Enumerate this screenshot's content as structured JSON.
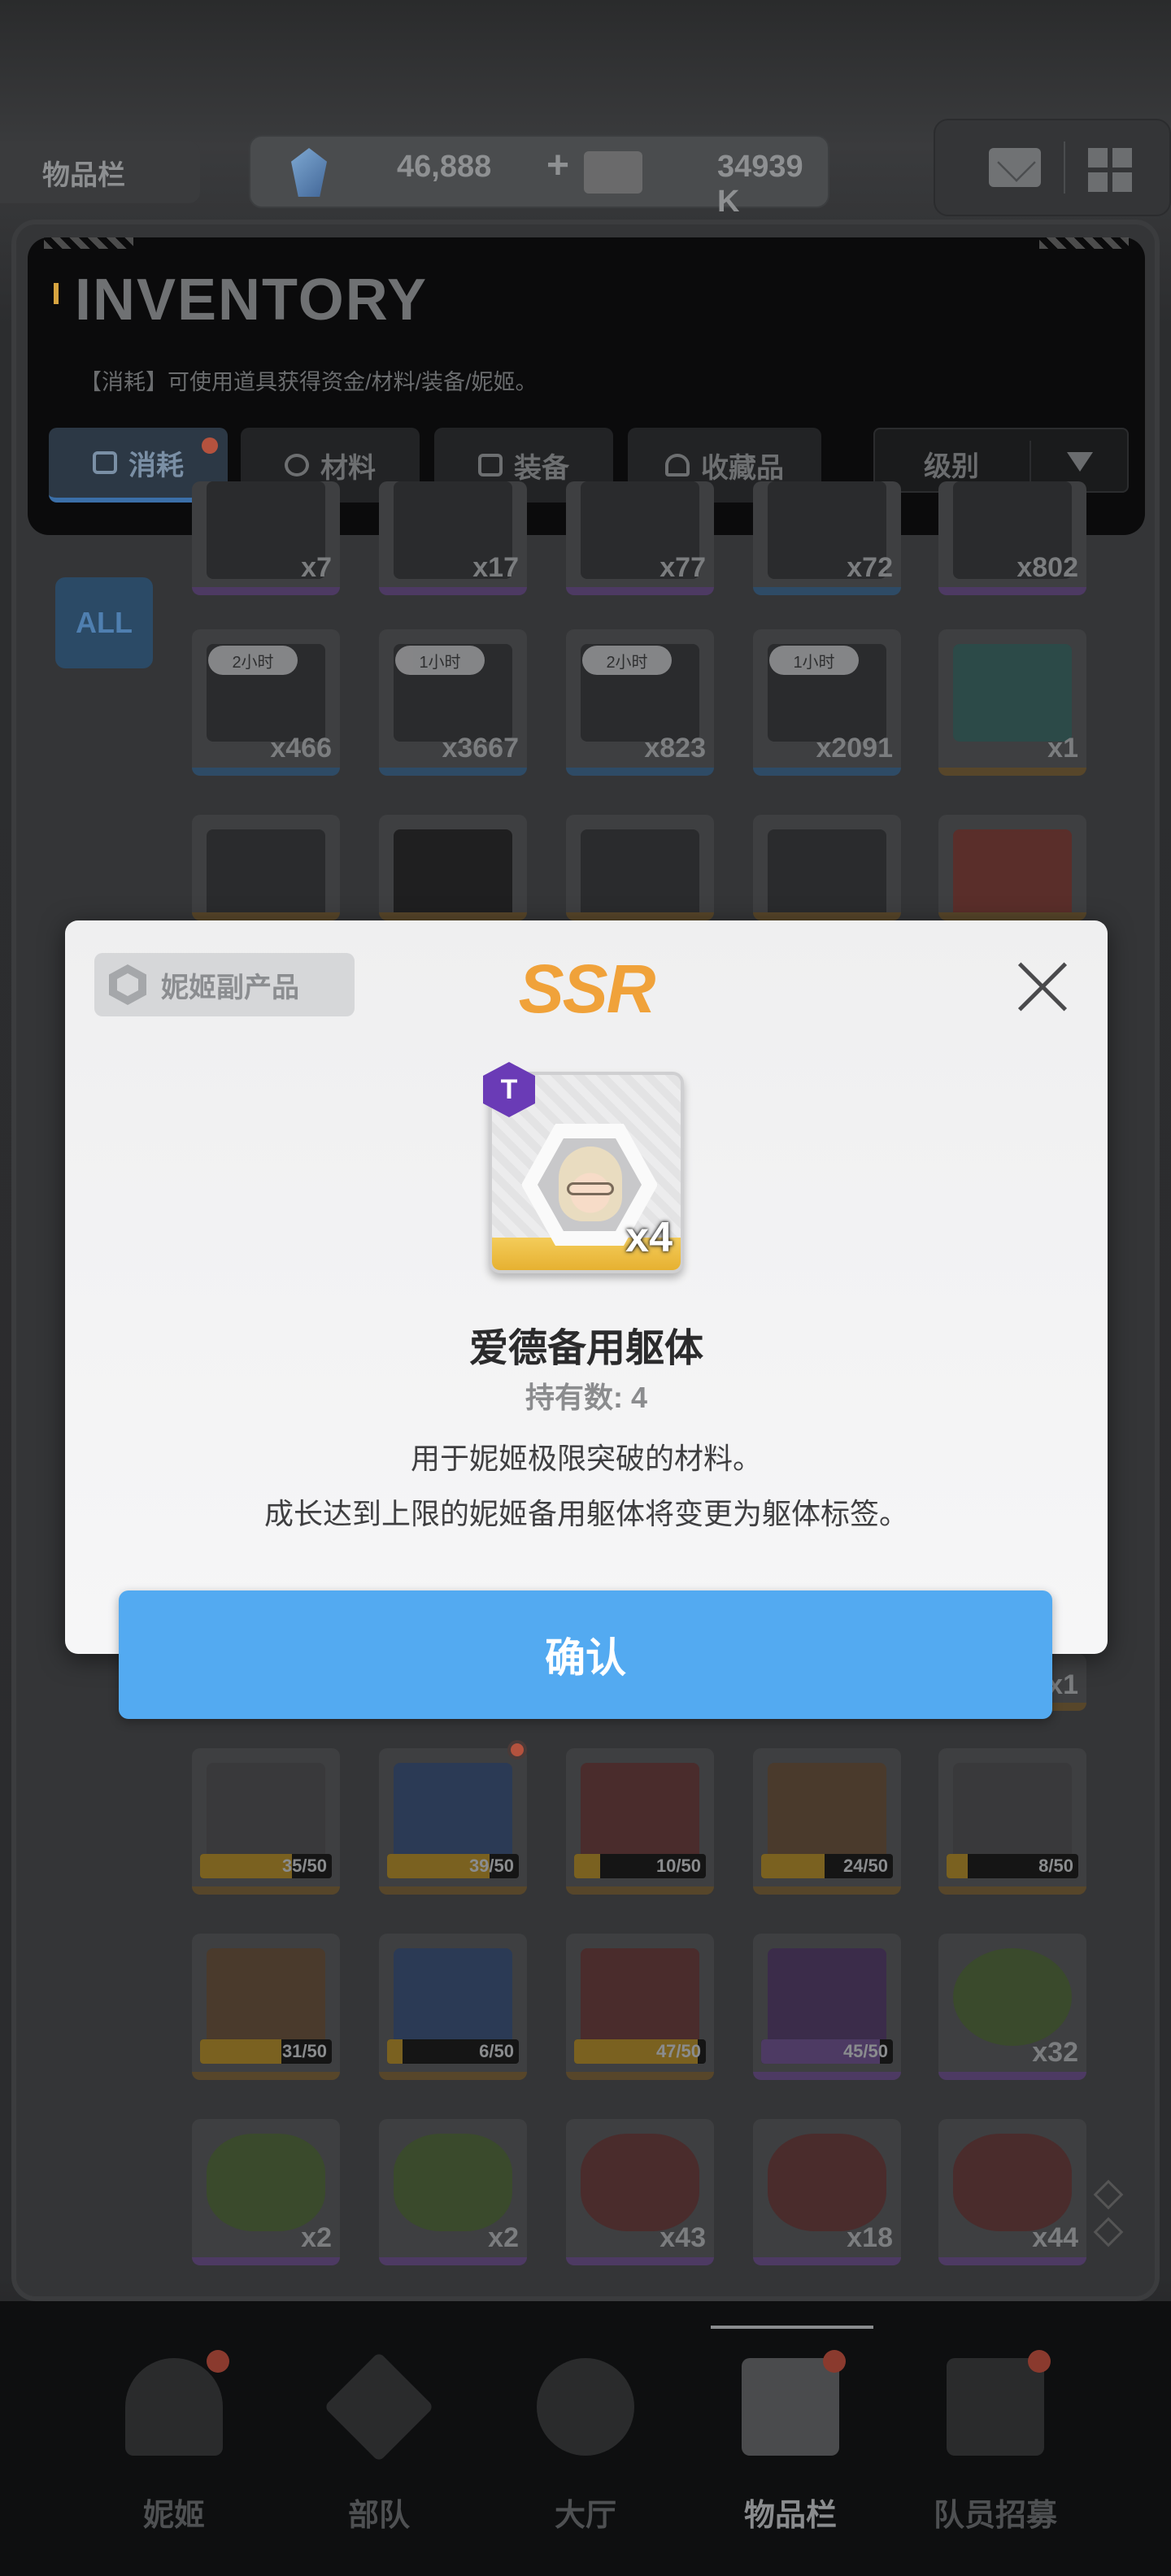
{
  "header": {
    "tag_label": "物品栏",
    "gem_amount": "46,888",
    "gem_plus": "+",
    "credits_amount": "34939 K"
  },
  "inventory": {
    "title": "INVENTORY",
    "subtitle": "【消耗】可使用道具获得资金/材料/装备/妮姬。",
    "tabs": [
      {
        "label": "消耗",
        "icon": "consumable-icon"
      },
      {
        "label": "材料",
        "icon": "material-icon"
      },
      {
        "label": "装备",
        "icon": "equipment-icon"
      },
      {
        "label": "收藏品",
        "icon": "collection-icon"
      }
    ],
    "sort_label": "级别",
    "all_label": "ALL",
    "row1_counts": [
      "x7",
      "x17",
      "x77",
      "x72",
      "x802"
    ],
    "row2": [
      {
        "timer": "2小时",
        "count": "x466"
      },
      {
        "timer": "1小时",
        "count": "x3667"
      },
      {
        "timer": "2小时",
        "count": "x823"
      },
      {
        "timer": "1小时",
        "count": "x2091"
      },
      {
        "timer": "",
        "count": "x1"
      }
    ],
    "hidden_count": "x1",
    "row_frag1": [
      {
        "progress": "35/50",
        "pct": 0.7
      },
      {
        "progress": "39/50",
        "pct": 0.78
      },
      {
        "progress": "10/50",
        "pct": 0.2
      },
      {
        "progress": "24/50",
        "pct": 0.48
      },
      {
        "progress": "8/50",
        "pct": 0.16
      }
    ],
    "row_frag2": [
      {
        "progress": "31/50",
        "pct": 0.62
      },
      {
        "progress": "6/50",
        "pct": 0.12
      },
      {
        "progress": "47/50",
        "pct": 0.94
      },
      {
        "progress": "45/50",
        "pct": 0.9
      },
      {
        "progress": "x32",
        "pct": 0
      }
    ],
    "row_last_counts": [
      "x2",
      "x2",
      "x43",
      "x18",
      "x44"
    ]
  },
  "modal": {
    "category": "妮姬副产品",
    "rarity": "SSR",
    "tier_badge": "T",
    "quantity_badge": "x4",
    "item_name": "爱德备用躯体",
    "owned": "持有数: 4",
    "desc_line1": "用于妮姬极限突破的材料。",
    "desc_line2": "成长达到上限的妮姬备用躯体将变更为躯体标签。",
    "confirm_label": "确认"
  },
  "nav": {
    "items": [
      {
        "label": "妮姬"
      },
      {
        "label": "部队"
      },
      {
        "label": "大厅"
      },
      {
        "label": "物品栏"
      },
      {
        "label": "队员招募"
      }
    ]
  }
}
